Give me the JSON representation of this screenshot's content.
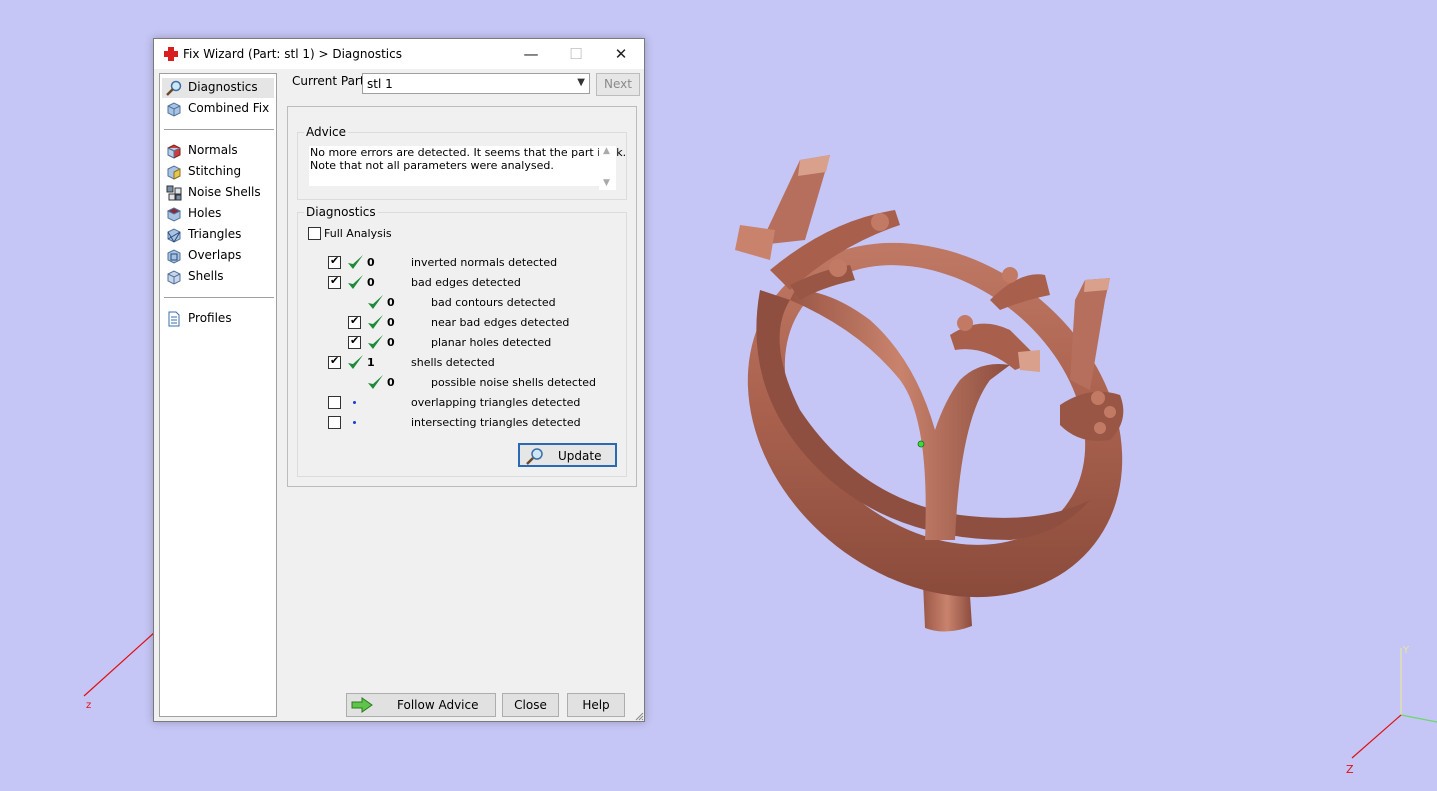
{
  "window": {
    "title": "Fix Wizard (Part: stl 1) > Diagnostics",
    "minimize_glyph": "—",
    "maximize_glyph": "☐",
    "close_glyph": "✕"
  },
  "nav": {
    "items": [
      {
        "label": "Diagnostics",
        "icon": "magnifier-icon",
        "selected": true
      },
      {
        "label": "Combined Fix",
        "icon": "cube-icon"
      },
      {
        "label": "Normals",
        "icon": "normals-icon"
      },
      {
        "label": "Stitching",
        "icon": "stitching-icon"
      },
      {
        "label": "Noise Shells",
        "icon": "noise-shells-icon"
      },
      {
        "label": "Holes",
        "icon": "holes-icon"
      },
      {
        "label": "Triangles",
        "icon": "triangles-icon"
      },
      {
        "label": "Overlaps",
        "icon": "overlaps-icon"
      },
      {
        "label": "Shells",
        "icon": "shells-icon"
      },
      {
        "label": "Profiles",
        "icon": "document-icon"
      }
    ]
  },
  "current_part": {
    "label": "Current Part:",
    "value": "stl 1",
    "next_label": "Next"
  },
  "advice": {
    "title": "Advice",
    "line1": "No more errors are detected. It seems that the part is ok.",
    "line2": "Note that not all parameters were analysed."
  },
  "diagnostics": {
    "title": "Diagnostics",
    "full_analysis_label": "Full Analysis",
    "full_analysis_checked": false,
    "rows": [
      {
        "label": "inverted normals detected",
        "value": "0",
        "checked": true,
        "status": "ok"
      },
      {
        "label": "bad edges detected",
        "value": "0",
        "checked": true,
        "status": "ok"
      },
      {
        "label": "bad contours detected",
        "value": "0",
        "status": "ok"
      },
      {
        "label": "near bad edges detected",
        "value": "0",
        "checked": true,
        "status": "ok"
      },
      {
        "label": "planar holes detected",
        "value": "0",
        "checked": true,
        "status": "ok"
      },
      {
        "label": "shells detected",
        "value": "1",
        "checked": true,
        "status": "ok"
      },
      {
        "label": "possible noise shells detected",
        "value": "0",
        "status": "ok"
      },
      {
        "label": "overlapping triangles detected",
        "checked": false,
        "status": "not-analysed"
      },
      {
        "label": "intersecting triangles detected",
        "checked": false,
        "status": "not-analysed"
      }
    ],
    "update_label": "Update"
  },
  "footer": {
    "follow_advice_label": "Follow Advice",
    "close_label": "Close",
    "help_label": "Help"
  },
  "viewport": {
    "axis_z_left": "z",
    "axis_y": "Y",
    "axis_z": "Z",
    "model_color": "#b56f5c",
    "background_color": "#c6c6f6"
  }
}
